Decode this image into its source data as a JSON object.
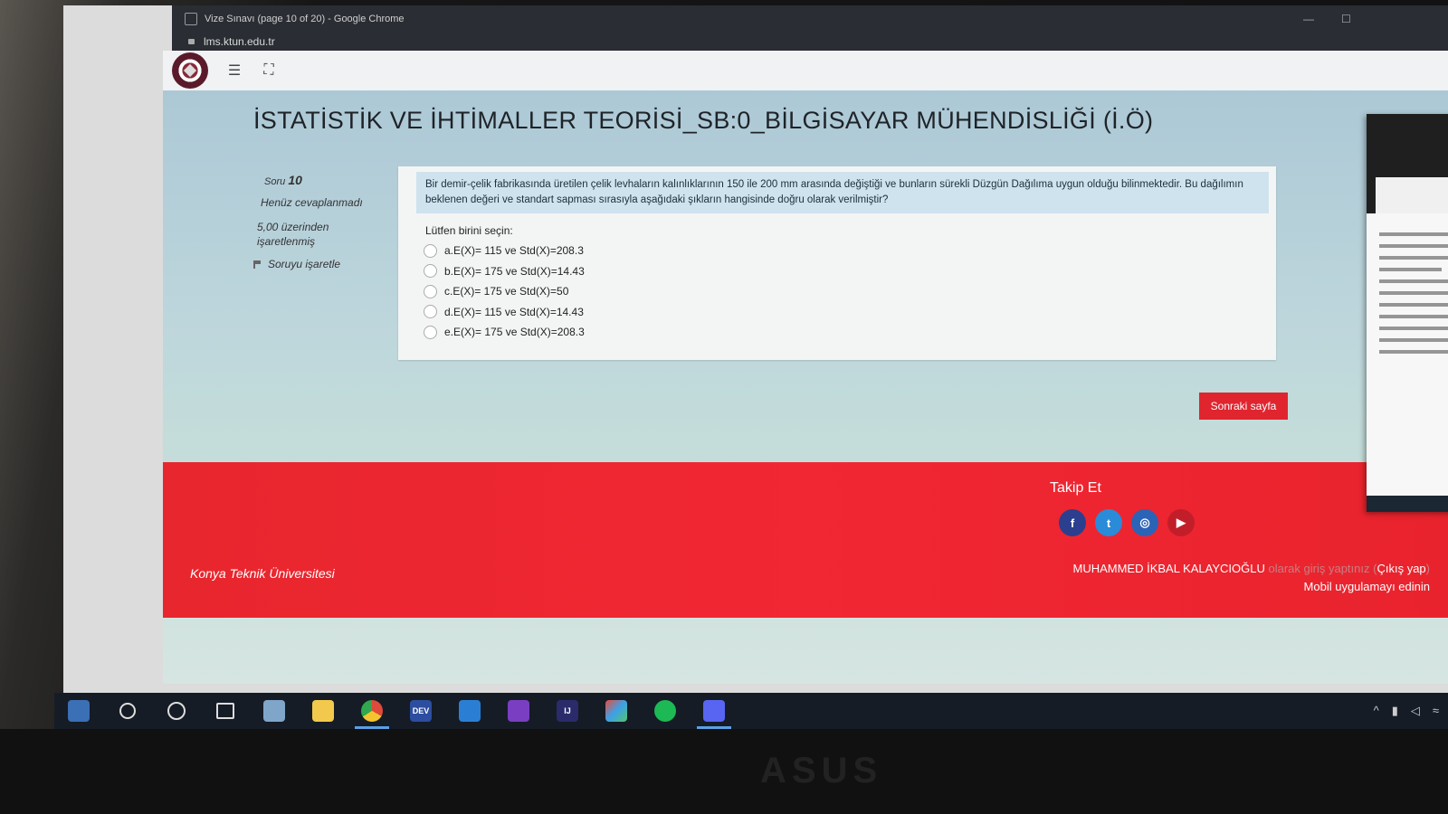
{
  "window": {
    "title": "Vize Sınavı (page 10 of 20) - Google Chrome",
    "url": "lms.ktun.edu.tr",
    "minimize": "—",
    "maximize": "☐"
  },
  "course": {
    "title": "İSTATİSTİK VE İHTİMALLER TEORİSİ_SB:0_BİLGİSAYAR MÜHENDİSLİĞİ (İ.Ö)"
  },
  "question_info": {
    "label": "Soru",
    "number": "10",
    "state": "Henüz cevaplanmadı",
    "marks": "5,00 üzerinden işaretlenmiş",
    "flag_label": "Soruyu işaretle"
  },
  "question": {
    "text": "Bir demir-çelik fabrikasında üretilen çelik levhaların kalınlıklarının 150 ile 200 mm arasında değiştiği ve bunların sürekli Düzgün Dağılıma uygun olduğu bilinmektedir. Bu dağılımın beklenen değeri ve standart sapması sırasıyla aşağıdaki şıkların hangisinde doğru olarak verilmiştir?",
    "prompt": "Lütfen birini seçin:",
    "options": [
      "a.E(X)= 115 ve Std(X)=208.3",
      "b.E(X)= 175 ve Std(X)=14.43",
      "c.E(X)= 175 ve Std(X)=50",
      "d.E(X)= 115 ve Std(X)=14.43",
      "e.E(X)= 175 ve Std(X)=208.3"
    ]
  },
  "navigation": {
    "next_label": "Sonraki sayfa"
  },
  "footer": {
    "follow_label": "Takip Et",
    "social": [
      "facebook-icon",
      "twitter-icon",
      "instagram-icon",
      "youtube-icon"
    ],
    "university": "Konya Teknik Üniversitesi",
    "user_name": "MUHAMMED İKBAL KALAYCIOĞLU",
    "logged_in_text": "olarak giriş yaptınız",
    "logout_label": "Çıkış yap",
    "mobile_app_label": "Mobil uygulamayı edinin"
  },
  "taskbar": {
    "items": [
      "windows-start-icon",
      "search-icon",
      "cortana-icon",
      "task-view-icon",
      "app-icon",
      "file-explorer-icon",
      "chrome-icon",
      "devc-icon",
      "vscode-icon",
      "visual-studio-icon",
      "intellij-icon",
      "3d-app-icon",
      "spotify-icon",
      "discord-icon"
    ],
    "dev_label": "DEV",
    "ij_label": "IJ"
  },
  "brand": "ASUS",
  "colors": {
    "accent_red": "#e8262e",
    "button_red": "#e0252f",
    "question_bg": "#cfe3ee"
  }
}
